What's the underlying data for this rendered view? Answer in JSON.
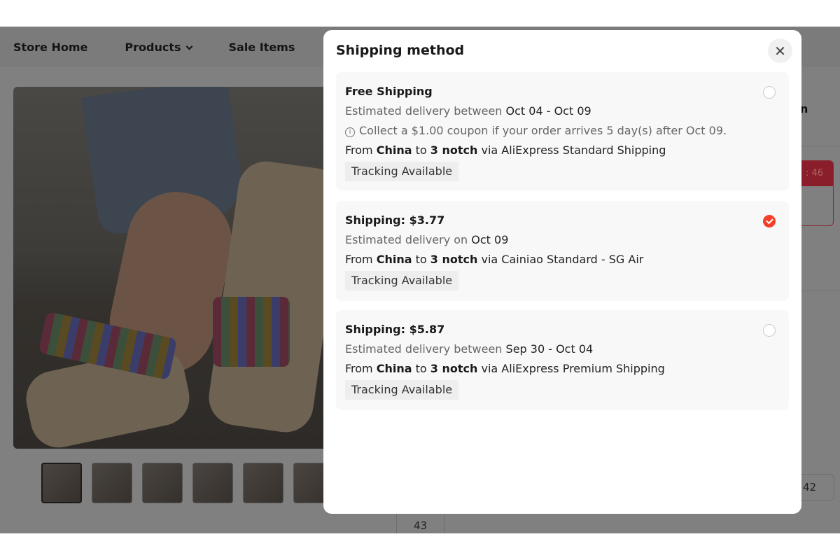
{
  "nav": {
    "items": [
      "Store Home",
      "Products",
      "Sale Items"
    ]
  },
  "background": {
    "partial_heading": "n",
    "timer_fragment": ": 46",
    "sizes": [
      "42",
      "43"
    ]
  },
  "modal": {
    "title": "Shipping method",
    "close_icon": "close-icon",
    "options": [
      {
        "title": "Free Shipping",
        "delivery_prefix": "Estimated delivery between",
        "delivery_dates": "Oct 04 - Oct 09",
        "coupon_note": "Collect a $1.00 coupon if your order arrives 5 day(s) after Oct 09.",
        "from_label": "From",
        "origin": "China",
        "to_label": "to",
        "destination": "3 notch",
        "via": "via AliExpress Standard Shipping",
        "tag": "Tracking Available",
        "selected": false
      },
      {
        "title": "Shipping: $3.77",
        "delivery_prefix": "Estimated delivery on",
        "delivery_dates": "Oct 09",
        "from_label": "From",
        "origin": "China",
        "to_label": "to",
        "destination": "3 notch",
        "via": "via Cainiao Standard - SG Air",
        "tag": "Tracking Available",
        "selected": true
      },
      {
        "title": "Shipping: $5.87",
        "delivery_prefix": "Estimated delivery between",
        "delivery_dates": "Sep 30 - Oct 04",
        "from_label": "From",
        "origin": "China",
        "to_label": "to",
        "destination": "3 notch",
        "via": "via AliExpress Premium Shipping",
        "tag": "Tracking Available",
        "selected": false
      }
    ]
  },
  "colors": {
    "accent": "#f4402b",
    "overlay": "#808080"
  }
}
